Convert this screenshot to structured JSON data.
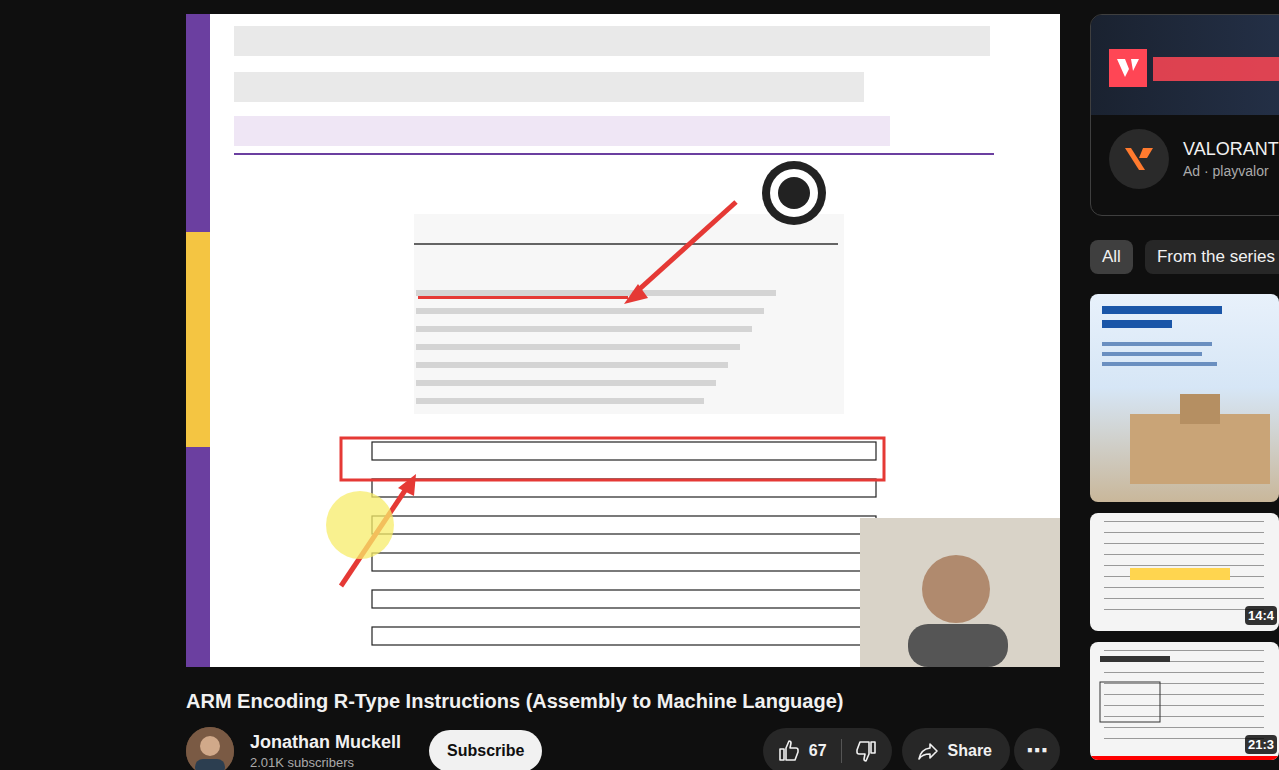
{
  "video": {
    "title": "ARM Encoding R-Type Instructions (Assembly to Machine Language)"
  },
  "channel": {
    "name": "Jonathan Muckell",
    "subscribers": "2.01K subscribers",
    "subscribe": "Subscribe"
  },
  "actions": {
    "likes": "67",
    "share": "Share",
    "more": "⋯"
  },
  "sidebar": {
    "ad": {
      "name": "VALORANT",
      "meta": "Ad · playvalor"
    },
    "chips": [
      {
        "label": "All",
        "selected": true
      },
      {
        "label": "From the series",
        "selected": false
      }
    ],
    "items": [
      {
        "kind": "promo"
      },
      {
        "kind": "video",
        "duration": "14:4",
        "level": 0
      },
      {
        "kind": "video",
        "duration": "21:3",
        "level": 1
      }
    ]
  }
}
